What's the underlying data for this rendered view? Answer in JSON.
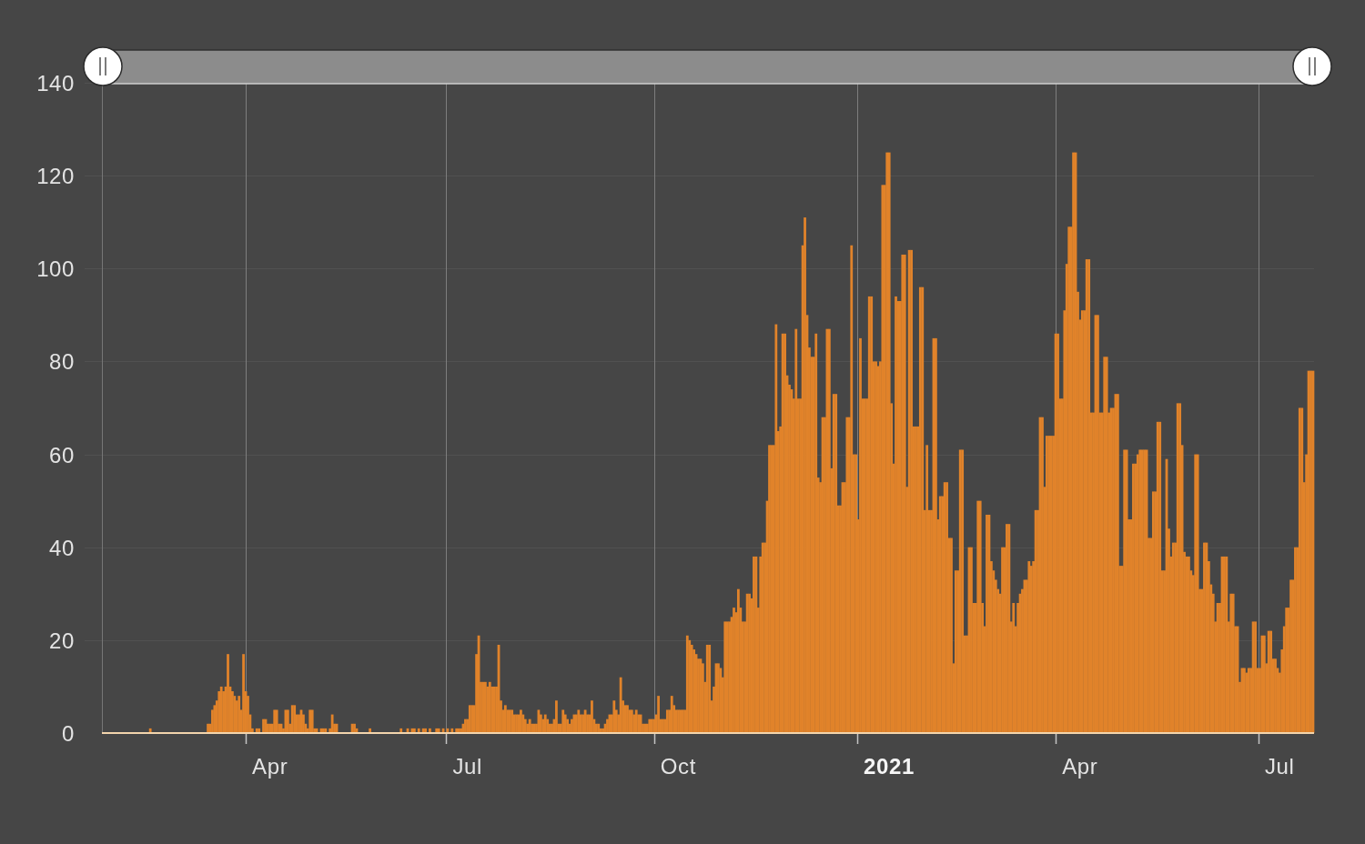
{
  "range_slider": {
    "handles": [
      {
        "level": 0
      },
      {
        "level": 1
      }
    ]
  },
  "chart": {
    "x_tick_labels": [
      {
        "bold": false
      },
      {
        "bold": false
      },
      {
        "bold": false
      },
      {
        "bold": true
      },
      {
        "bold": false
      },
      {
        "bold": false
      }
    ],
    "chart_data": {
      "type": "bar",
      "grid": true,
      "ylim": [
        0,
        140
      ],
      "yticks": [
        0,
        20,
        40,
        60,
        80,
        100,
        120,
        140
      ],
      "categories": [
        null,
        null,
        null,
        null,
        null,
        null,
        null,
        null,
        null,
        null,
        null,
        null,
        null,
        null,
        null,
        null,
        null,
        null,
        null,
        null,
        null,
        null,
        null,
        null,
        null,
        null,
        null,
        null,
        null,
        null,
        null,
        null,
        null,
        null,
        null,
        null,
        null,
        null,
        null,
        null,
        null,
        null,
        null,
        null,
        null,
        null,
        null,
        null,
        null,
        null,
        null,
        null,
        null,
        null,
        null,
        null,
        null,
        null,
        null,
        null,
        null,
        null,
        null,
        null,
        null,
        null,
        null,
        null,
        null,
        null,
        null,
        null,
        null,
        null,
        "Apr",
        null,
        null,
        null,
        null,
        null,
        null,
        null,
        null,
        null,
        null,
        null,
        null,
        null,
        null,
        null,
        null,
        null,
        null,
        null,
        null,
        null,
        null,
        null,
        null,
        null,
        null,
        null,
        null,
        null,
        null,
        null,
        null,
        null,
        null,
        null,
        null,
        null,
        null,
        null,
        null,
        null,
        null,
        null,
        null,
        null,
        null,
        null,
        null,
        null,
        null,
        null,
        null,
        null,
        null,
        null,
        null,
        null,
        null,
        null,
        null,
        null,
        null,
        null,
        null,
        null,
        null,
        null,
        null,
        null,
        null,
        null,
        null,
        null,
        null,
        null,
        null,
        null,
        null,
        null,
        null,
        null,
        null,
        null,
        null,
        null,
        null,
        null,
        null,
        "Jul",
        null,
        null,
        null,
        null,
        null,
        null,
        null,
        null,
        null,
        null,
        null,
        null,
        null,
        null,
        null,
        null,
        null,
        null,
        null,
        null,
        null,
        null,
        null,
        null,
        null,
        null,
        null,
        null,
        null,
        null,
        null,
        null,
        null,
        null,
        null,
        null,
        null,
        null,
        null,
        null,
        null,
        null,
        null,
        null,
        null,
        null,
        null,
        null,
        null,
        null,
        null,
        null,
        null,
        null,
        null,
        null,
        null,
        null,
        null,
        null,
        null,
        null,
        null,
        null,
        null,
        null,
        null,
        null,
        null,
        null,
        null,
        null,
        null,
        null,
        null,
        null,
        null,
        null,
        null,
        null,
        null,
        null,
        null,
        null,
        null,
        null,
        null,
        null,
        null,
        null,
        null,
        null,
        null,
        null,
        "Oct",
        null,
        null,
        null,
        null,
        null,
        null,
        null,
        null,
        null,
        null,
        null,
        null,
        null,
        null,
        null,
        null,
        null,
        null,
        null,
        null,
        null,
        null,
        null,
        null,
        null,
        null,
        null,
        null,
        null,
        null,
        null,
        null,
        null,
        null,
        null,
        null,
        null,
        null,
        null,
        null,
        null,
        null,
        null,
        null,
        null,
        null,
        null,
        null,
        null,
        null,
        null,
        null,
        null,
        null,
        null,
        null,
        null,
        null,
        null,
        null,
        null,
        null,
        null,
        null,
        null,
        null,
        null,
        null,
        null,
        null,
        null,
        null,
        null,
        null,
        null,
        null,
        null,
        null,
        null,
        null,
        null,
        null,
        null,
        null,
        null,
        null,
        null,
        null,
        null,
        null,
        null,
        null,
        null,
        null,
        "2021",
        null,
        null,
        null,
        null,
        null,
        null,
        null,
        null,
        null,
        null,
        null,
        null,
        null,
        null,
        null,
        null,
        null,
        null,
        null,
        null,
        null,
        null,
        null,
        null,
        null,
        null,
        null,
        null,
        null,
        null,
        null,
        null,
        null,
        null,
        null,
        null,
        null,
        null,
        null,
        null,
        null,
        null,
        null,
        null,
        null,
        null,
        null,
        null,
        null,
        null,
        null,
        null,
        null,
        null,
        null,
        null,
        null,
        null,
        null,
        null,
        null,
        null,
        null,
        null,
        null,
        null,
        null,
        null,
        null,
        null,
        null,
        null,
        null,
        null,
        null,
        null,
        null,
        null,
        null,
        null,
        null,
        null,
        null,
        null,
        null,
        "Apr",
        null,
        null,
        null,
        null,
        null,
        null,
        null,
        null,
        null,
        null,
        null,
        null,
        null,
        null,
        null,
        null,
        null,
        null,
        null,
        null,
        null,
        null,
        null,
        null,
        null,
        null,
        null,
        null,
        null,
        null,
        null,
        null,
        null,
        null,
        null,
        null,
        null,
        null,
        null,
        null,
        null,
        null,
        null,
        null,
        null,
        null,
        null,
        null,
        null,
        null,
        null,
        null,
        null,
        null,
        null,
        null,
        null,
        null,
        null,
        null,
        null,
        null,
        null,
        null,
        null,
        null,
        null,
        null,
        null,
        null,
        null,
        null,
        null,
        null,
        null,
        null,
        null,
        null,
        null,
        null,
        null,
        null,
        null,
        null,
        null,
        null,
        null,
        null,
        null,
        "Jul",
        null,
        null,
        null,
        null,
        null,
        null,
        null,
        null,
        null,
        null,
        null,
        null,
        null,
        null,
        null
      ],
      "series": [
        {
          "color": "#e1832a",
          "values": [
            0,
            0,
            0,
            0,
            0,
            0,
            0,
            0,
            0,
            0,
            0,
            0,
            0,
            0,
            0,
            0,
            0,
            0,
            0,
            0,
            1,
            0,
            0,
            0,
            0,
            0,
            0,
            0,
            0,
            0,
            0,
            0,
            0,
            0,
            0,
            0,
            0,
            0,
            0,
            0,
            0,
            0,
            0,
            0,
            0,
            0,
            2,
            2,
            5,
            6,
            7,
            9,
            10,
            9,
            10,
            17,
            10,
            9,
            8,
            7,
            8,
            5,
            17,
            9,
            8,
            4,
            1,
            0,
            1,
            1,
            0,
            3,
            3,
            2,
            2,
            2,
            5,
            5,
            2,
            2,
            1,
            5,
            5,
            2,
            6,
            6,
            4,
            4,
            5,
            4,
            2,
            1,
            5,
            5,
            1,
            1,
            0,
            1,
            1,
            1,
            0,
            1,
            4,
            2,
            2,
            0,
            0,
            0,
            0,
            0,
            0,
            2,
            2,
            1,
            0,
            0,
            0,
            0,
            0,
            1,
            0,
            0,
            0,
            0,
            0,
            0,
            0,
            0,
            0,
            0,
            0,
            0,
            0,
            1,
            0,
            0,
            1,
            0,
            1,
            1,
            0,
            1,
            0,
            1,
            1,
            0,
            1,
            0,
            0,
            1,
            1,
            0,
            1,
            0,
            1,
            0,
            1,
            0,
            1,
            1,
            1,
            2,
            3,
            3,
            6,
            6,
            6,
            17,
            21,
            11,
            11,
            11,
            10,
            11,
            10,
            10,
            10,
            19,
            7,
            5,
            6,
            5,
            5,
            5,
            4,
            4,
            4,
            5,
            4,
            3,
            2,
            3,
            2,
            2,
            2,
            5,
            4,
            3,
            4,
            3,
            2,
            2,
            3,
            7,
            2,
            2,
            5,
            4,
            3,
            2,
            3,
            4,
            4,
            5,
            4,
            4,
            5,
            4,
            4,
            7,
            3,
            2,
            2,
            1,
            1,
            2,
            3,
            4,
            4,
            7,
            5,
            4,
            12,
            7,
            6,
            6,
            5,
            5,
            4,
            5,
            4,
            4,
            2,
            2,
            2,
            3,
            3,
            3,
            4,
            8,
            3,
            3,
            3,
            5,
            5,
            8,
            6,
            5,
            5,
            5,
            5,
            5,
            21,
            20,
            19,
            18,
            17,
            16,
            16,
            15,
            11,
            19,
            19,
            7,
            10,
            15,
            15,
            14,
            12,
            24,
            24,
            24,
            25,
            27,
            26,
            31,
            27,
            24,
            24,
            30,
            30,
            29,
            38,
            38,
            27,
            38,
            41,
            41,
            50,
            62,
            62,
            62,
            88,
            65,
            66,
            86,
            86,
            77,
            75,
            74,
            72,
            87,
            72,
            72,
            105,
            111,
            90,
            83,
            81,
            81,
            86,
            55,
            54,
            68,
            68,
            87,
            87,
            57,
            73,
            73,
            49,
            49,
            54,
            54,
            68,
            68,
            105,
            60,
            60,
            46,
            85,
            72,
            72,
            72,
            94,
            94,
            80,
            80,
            79,
            80,
            118,
            118,
            125,
            125,
            71,
            58,
            94,
            93,
            93,
            103,
            103,
            53,
            104,
            104,
            66,
            66,
            66,
            96,
            96,
            48,
            62,
            48,
            48,
            85,
            85,
            46,
            51,
            51,
            54,
            54,
            42,
            42,
            15,
            35,
            35,
            61,
            61,
            21,
            21,
            40,
            40,
            28,
            28,
            50,
            50,
            28,
            23,
            47,
            47,
            37,
            35,
            33,
            31,
            30,
            40,
            40,
            45,
            45,
            24,
            28,
            23,
            28,
            30,
            31,
            33,
            33,
            37,
            36,
            37,
            48,
            48,
            68,
            68,
            53,
            64,
            64,
            64,
            64,
            86,
            86,
            72,
            72,
            91,
            101,
            109,
            109,
            125,
            125,
            95,
            89,
            91,
            91,
            102,
            102,
            69,
            69,
            90,
            90,
            69,
            69,
            81,
            81,
            69,
            70,
            70,
            73,
            73,
            36,
            36,
            61,
            61,
            46,
            46,
            58,
            58,
            60,
            61,
            61,
            61,
            61,
            42,
            42,
            52,
            52,
            67,
            67,
            35,
            35,
            59,
            44,
            38,
            41,
            41,
            71,
            71,
            62,
            39,
            38,
            38,
            35,
            34,
            60,
            60,
            31,
            31,
            41,
            41,
            37,
            32,
            30,
            24,
            28,
            28,
            38,
            38,
            38,
            24,
            30,
            30,
            23,
            23,
            11,
            14,
            14,
            13,
            14,
            14,
            24,
            24,
            14,
            14,
            21,
            21,
            15,
            22,
            22,
            16,
            16,
            14,
            13,
            18,
            23,
            27,
            27,
            33,
            33,
            40,
            40,
            70,
            70,
            54,
            60,
            78,
            78,
            78
          ]
        }
      ]
    }
  }
}
